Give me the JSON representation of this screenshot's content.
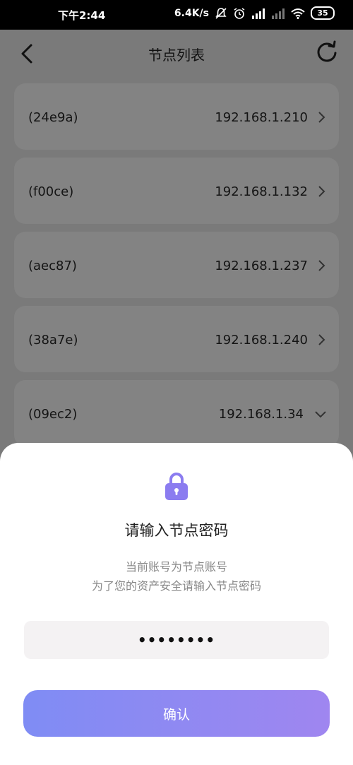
{
  "status_bar": {
    "time": "下午2:44",
    "network_speed": "6.4K/s",
    "battery": "35"
  },
  "header": {
    "title": "节点列表"
  },
  "nodes": [
    {
      "name": "(24e9a)",
      "ip": "192.168.1.210",
      "chevron": "chevron-right-icon"
    },
    {
      "name": "(f00ce)",
      "ip": "192.168.1.132",
      "chevron": "chevron-right-icon"
    },
    {
      "name": "(aec87)",
      "ip": "192.168.1.237",
      "chevron": "chevron-right-icon"
    },
    {
      "name": "(38a7e)",
      "ip": "192.168.1.240",
      "chevron": "chevron-right-icon"
    },
    {
      "name": "(09ec2)",
      "ip": "192.168.1.34",
      "chevron": "chevron-down-icon"
    }
  ],
  "dialog": {
    "title": "请输入节点密码",
    "desc_line1": "当前账号为节点账号",
    "desc_line2": "为了您的资产安全请输入节点密码",
    "password_value": "••••••••",
    "confirm_label": "确认",
    "accent_color": "#8b7cf0"
  }
}
